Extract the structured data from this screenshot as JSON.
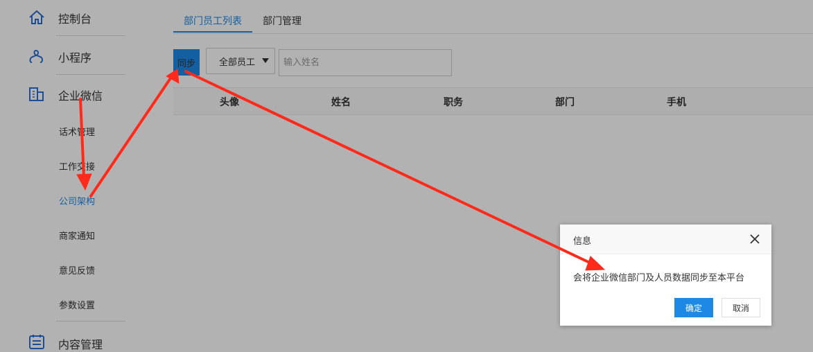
{
  "sidebar": {
    "main_items": [
      {
        "label": "控制台",
        "icon": "home-icon"
      },
      {
        "label": "小程序",
        "icon": "link-icon"
      },
      {
        "label": "企业微信",
        "icon": "building-icon"
      },
      {
        "label": "内容管理",
        "icon": "calendar-list-icon"
      }
    ],
    "sub_items": [
      {
        "label": "话术管理"
      },
      {
        "label": "工作交接"
      },
      {
        "label": "公司架构",
        "active": true
      },
      {
        "label": "商家通知"
      },
      {
        "label": "意见反馈"
      },
      {
        "label": "参数设置"
      }
    ]
  },
  "main": {
    "tabs": [
      {
        "label": "部门员工列表",
        "active": true
      },
      {
        "label": "部门管理"
      }
    ],
    "toolbar": {
      "sync_label": "同步",
      "filter_selected": "全部员工",
      "search_placeholder": "输入姓名"
    },
    "table": {
      "columns": [
        "头像",
        "姓名",
        "职务",
        "部门",
        "手机"
      ]
    }
  },
  "dialog": {
    "title": "信息",
    "message": "会将企业微信部门及人员数据同步至本平台",
    "ok_label": "确定",
    "cancel_label": "取消"
  },
  "colors": {
    "accent": "#1e88e5",
    "annotation_arrow": "#ff2a1a"
  }
}
